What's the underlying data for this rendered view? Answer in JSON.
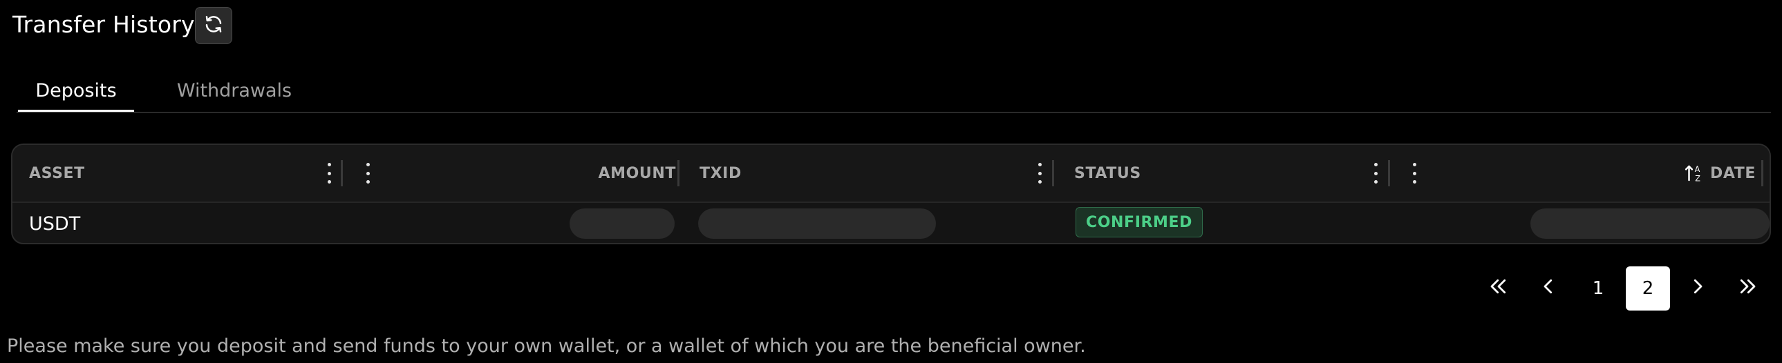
{
  "header": {
    "title": "Transfer History",
    "refresh_icon": "refresh-icon"
  },
  "tabs": [
    {
      "label": "Deposits",
      "active": true
    },
    {
      "label": "Withdrawals",
      "active": false
    }
  ],
  "table": {
    "columns": [
      "ASSET",
      "AMOUNT",
      "TXID",
      "STATUS",
      "DATE"
    ],
    "sort_icon": "sort-ascending-icon",
    "rows": [
      {
        "asset": "USDT",
        "amount": "",
        "txid": "",
        "status": "CONFIRMED",
        "date": ""
      }
    ]
  },
  "pagination": {
    "first": "«",
    "prev": "‹",
    "pages": [
      "1",
      "2"
    ],
    "current_page": "2",
    "next": "›",
    "last": "»"
  },
  "footer_note": "Please make sure you deposit and send funds to your own wallet, or a wallet of which you are the beneficial owner.",
  "colors": {
    "background": "#000000",
    "confirmed": "#4ccf88",
    "confirmed_bg": "#1b3325"
  }
}
